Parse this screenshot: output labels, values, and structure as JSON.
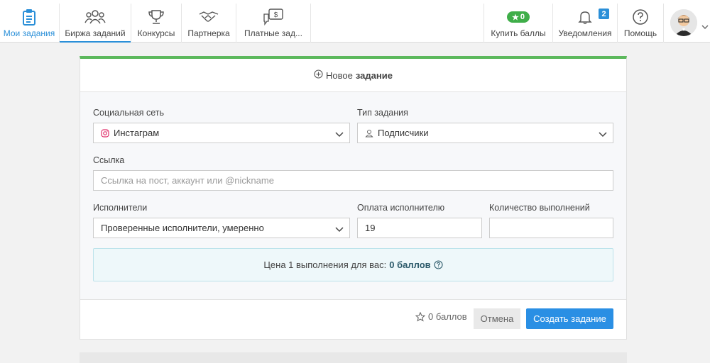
{
  "nav": {
    "my_tasks": "Мои задания",
    "exchange": "Биржа заданий",
    "contests": "Конкурсы",
    "partnership": "Партнерка",
    "paid_tasks": "Платные зад...",
    "buy_points": "Купить баллы",
    "buy_points_badge": "0",
    "notifications": "Уведомления",
    "notifications_count": "2",
    "help": "Помощь"
  },
  "form": {
    "header_prefix": "Новое",
    "header_bold": "задание",
    "social_label": "Социальная сеть",
    "social_value": "Инстаграм",
    "type_label": "Тип задания",
    "type_value": "Подписчики",
    "link_label": "Ссылка",
    "link_placeholder": "Ссылка на пост, аккаунт или @nickname",
    "performers_label": "Исполнители",
    "performers_value": "Проверенные исполнители, умеренно",
    "payment_label": "Оплата исполнителю",
    "payment_value": "19",
    "count_label": "Количество выполнений",
    "count_value": "",
    "price_text": "Цена 1 выполнения для вас:",
    "price_value": "0 баллов"
  },
  "footer": {
    "points": "0 баллов",
    "cancel": "Отмена",
    "create": "Создать задание"
  },
  "colors": {
    "accent": "#2a8fe4",
    "success": "#5cb85c",
    "badge_green": "#3fae49"
  }
}
